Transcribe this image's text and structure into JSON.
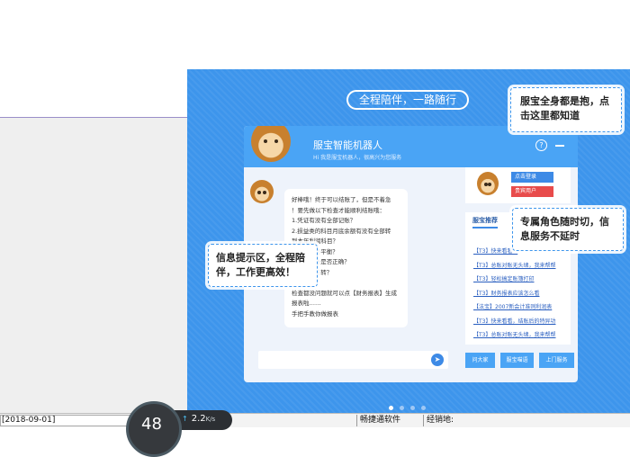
{
  "slogan": "全程陪伴，一路随行",
  "chat": {
    "bot_name": "服宝智能机器人",
    "bot_subtitle": "Hi 我是服宝机器人，很高兴为您服务",
    "help_glyph": "?",
    "message_lines": [
      "好棒哦！终于可以结账了，但是不着急",
      "！要先做以下检查才能顺利结账哦：",
      "1.凭证有没有全部记账？",
      "2.损益类的科目月底余额有没有全部转",
      "到本年利润科目？",
      "3.试算是否平衡？",
      "4.科目对账是否正确？",
      "5.有没有结转？",
      "",
      "检查都没问题就可以点【财务报表】生成",
      "报表啦……",
      "手把手教你做报表"
    ],
    "send_glyph": "➤"
  },
  "side": {
    "login_label": "点击登录",
    "vip_label": "贵宾用户",
    "recommend_tab": "服宝推荐",
    "recommend_items": [
      "【T3】快来看看...",
      "【T3】总账对账无头绪，我来帮帮",
      "【T3】轻松搞定账簿打印",
      "【T3】财务报表应该怎么看",
      "【法宝】2007新会计准则利润表",
      "【T3】快来看看，结账后的特异功",
      "【T3】总账对账无头绪，我来帮帮"
    ],
    "buttons": [
      "问大家",
      "服宝喵语",
      "上门服务"
    ]
  },
  "callouts": {
    "top": "服宝全身都是抱，点击这里都知道",
    "right": "专属角色随时切，信息服务不延时",
    "left": "信息提示区，全程陪伴，工作更高效！"
  },
  "carousel": {
    "count": 4,
    "active": 0
  },
  "taskbar": {
    "date": "[2018-09-01]",
    "gauge_value": "48",
    "speed_value": "2.2",
    "speed_unit": "K/s",
    "up_glyph": "↑",
    "app": "畅捷通软件",
    "dealer": "经销地:"
  },
  "colors": {
    "panel_blue": "#3d95ec",
    "header_blue": "#4aa4f5",
    "vip_red": "#e84b4b"
  }
}
